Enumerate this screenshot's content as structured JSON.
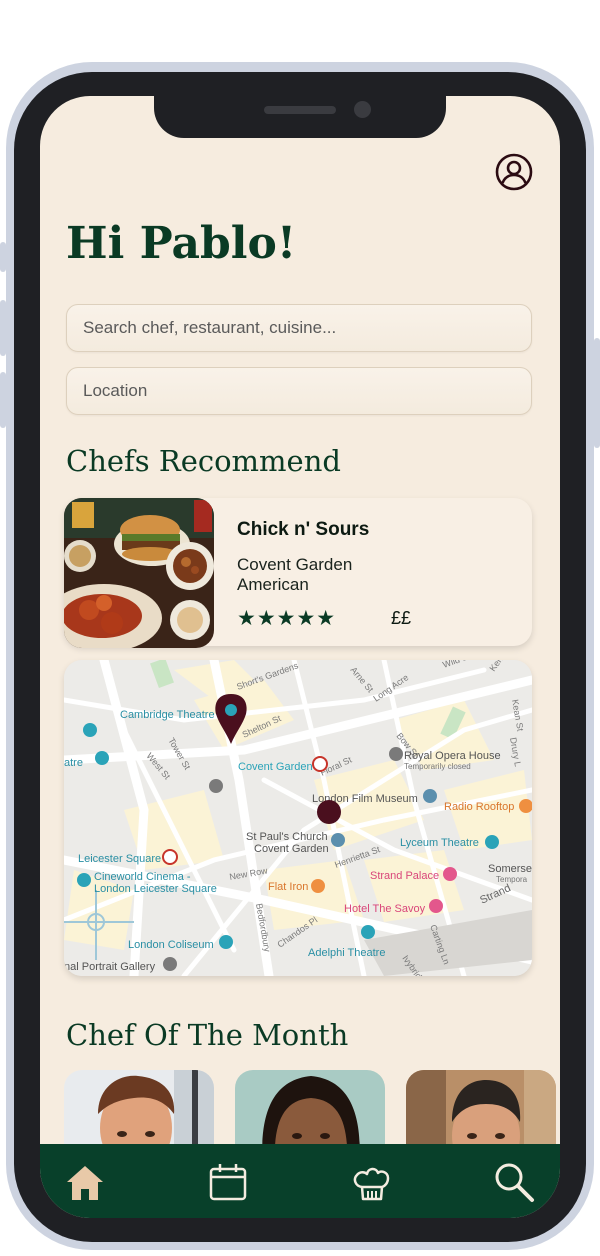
{
  "greeting": "Hi Pablo!",
  "search": {
    "placeholder": "Search chef, restaurant, cuisine..."
  },
  "location": {
    "placeholder": "Location"
  },
  "sections": {
    "recommend_title": "Chefs Recommend",
    "chef_month_title": "Chef Of The Month"
  },
  "recommendation": {
    "name": "Chick n' Sours",
    "area": "Covent Garden",
    "cuisine": "American",
    "rating_stars": "★★★★★",
    "price": "££"
  },
  "map": {
    "labels": {
      "cambridge_theatre": "Cambridge Theatre",
      "covent_garden": "Covent Garden",
      "royal_opera_house": "Royal Opera House",
      "temporarily_closed": "Temporarily closed",
      "london_film_museum": "London Film Museum",
      "radio_rooftop": "Radio Rooftop",
      "st_pauls_church": "St Paul's Church",
      "covent_garden_2": "Covent Garden",
      "lyceum_theatre": "Lyceum Theatre",
      "leicester_square": "Leicester Square",
      "cineworld_1": "Cineworld Cinema -",
      "cineworld_2": "London Leicester Square",
      "flat_iron": "Flat Iron",
      "strand_palace": "Strand Palace",
      "somerset": "Somerse",
      "somerset_2": "Tempora",
      "hotel_savoy": "Hotel The Savoy",
      "strand": "Strand",
      "london_coliseum": "London Coliseum",
      "adelphi_theatre": "Adelphi Theatre",
      "portrait_gallery": "nal Portrait Gallery",
      "atre": "atre",
      "new_row": "New Row",
      "shorts_gardens": "Short's Gardens",
      "shelton_st": "Shelton St",
      "long_acre": "Long Acre",
      "bow_st": "Bow St",
      "floral_st": "Floral St",
      "henrietta_st": "Henrietta St",
      "bedfordbury": "Bedfordbury",
      "chandos_pl": "Chandos Pl",
      "tower_st": "Tower St",
      "west_st": "West St",
      "arne_st": "Arne St",
      "wild_st": "Wild St",
      "kemble_st": "Kemble St",
      "keat_st": "Kean St",
      "drury_l": "Drury L",
      "carting_ln": "Carting Ln",
      "ivybridge": "Ivybridge"
    }
  },
  "nav": {
    "home": "home-icon",
    "calendar": "calendar-icon",
    "chef": "chef-hat-icon",
    "search": "search-icon"
  },
  "colors": {
    "brand_green": "#08402a",
    "background": "#f6ecdf",
    "pin": "#4a0f1e"
  }
}
